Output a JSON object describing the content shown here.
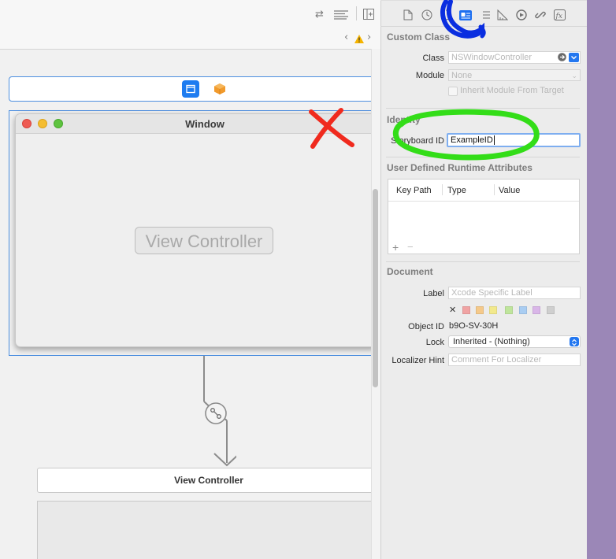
{
  "canvas": {
    "scene_window": {
      "title": "Window"
    },
    "placeholder_label": "View Controller",
    "second_scene_title": "View Controller"
  },
  "toolbar": {
    "icons": [
      "swap-icon",
      "lines-icon",
      "add-editor-icon",
      "chevron-left-icon",
      "warning-icon",
      "chevron-right-icon"
    ]
  },
  "inspector": {
    "tabs": [
      "file-icon",
      "history-icon",
      "help-icon",
      "identity-icon",
      "attributes-icon",
      "size-icon",
      "connections-icon",
      "bindings-icon",
      "effects-icon"
    ],
    "custom_class": {
      "title": "Custom Class",
      "class_label": "Class",
      "class_placeholder": "NSWindowController",
      "module_label": "Module",
      "module_placeholder": "None",
      "inherit_label": "Inherit Module From Target"
    },
    "identity": {
      "title": "Identity",
      "storyboard_id_label": "Storyboard ID",
      "storyboard_id_value": "ExampleID"
    },
    "runtime_attributes": {
      "title": "User Defined Runtime Attributes",
      "columns": [
        "Key Path",
        "Type",
        "Value"
      ],
      "add": "+",
      "remove": "−"
    },
    "document": {
      "title": "Document",
      "label_label": "Label",
      "label_placeholder": "Xcode Specific Label",
      "clear_mark": "✕",
      "swatch_colors": [
        "#f0a3a3",
        "#f5c98a",
        "#f2e98c",
        "#bfe59c",
        "#a9cdf2",
        "#d9b6e8",
        "#cfcfcf"
      ],
      "object_id_label": "Object ID",
      "object_id_value": "b9O-SV-30H",
      "lock_label": "Lock",
      "lock_value": "Inherited - (Nothing)",
      "localizer_label": "Localizer Hint",
      "localizer_placeholder": "Comment For Localizer"
    }
  },
  "annotations": {
    "blue_circle_color": "#0a2ee0",
    "green_circle_color": "#33dd18",
    "red_x_color": "#f02a1e"
  }
}
